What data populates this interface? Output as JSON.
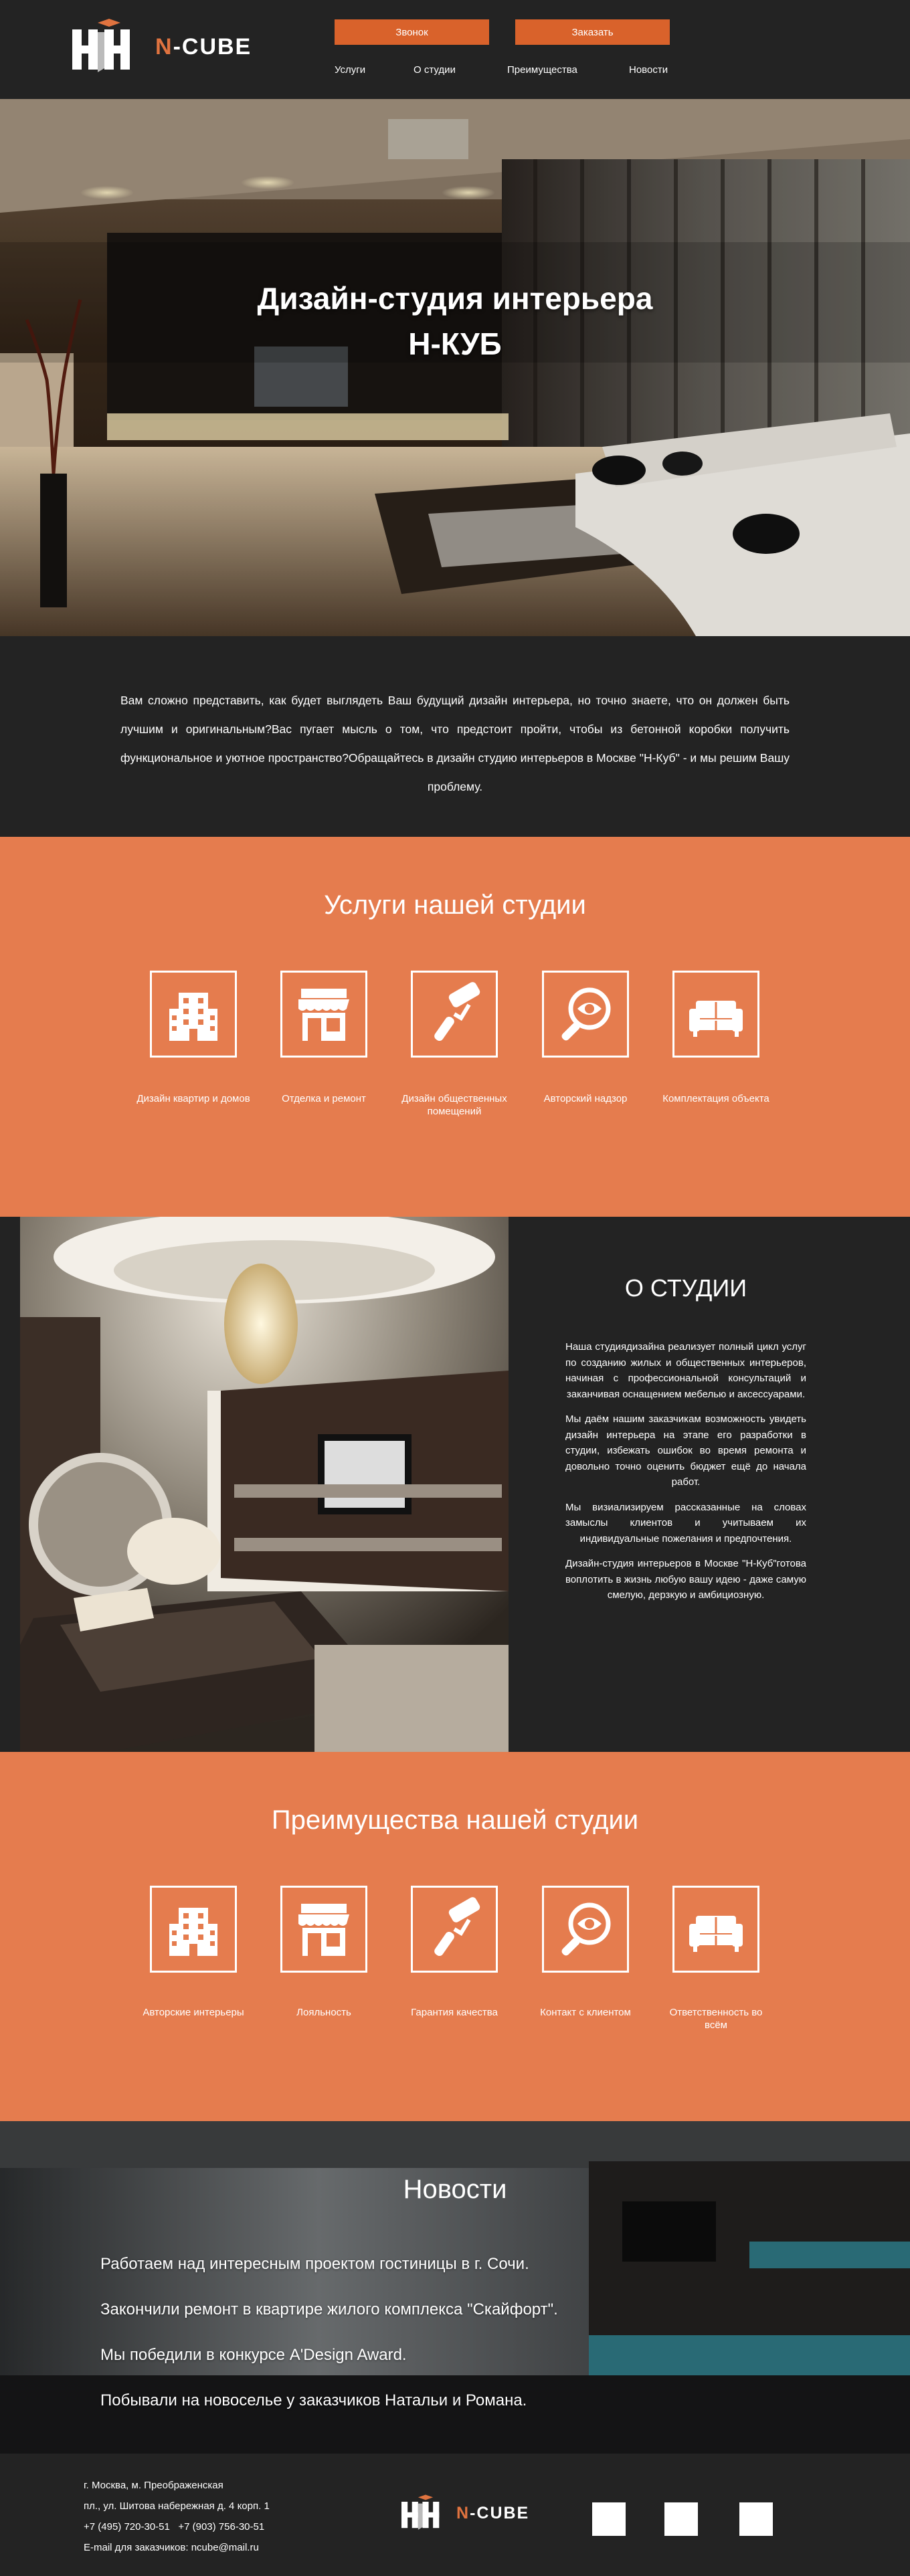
{
  "brand": {
    "logo_n": "N",
    "logo_rest": "-CUBE",
    "accent": "#d9622b",
    "orange_bg": "#e57c4e",
    "dark_bg": "#232323"
  },
  "header": {
    "call_button": "Звонок",
    "order_button": "Заказать",
    "nav": [
      "Услуги",
      "О студии",
      "Преимущества",
      "Новости"
    ]
  },
  "hero": {
    "title_line1": "Дизайн-студия интерьера",
    "title_line2": "Н-КУБ"
  },
  "intro": {
    "text": "Вам сложно представить, как будет выглядеть Ваш будущий дизайн интерьера, но точно знаете, что он должен быть лучшим и оригинальным?Вас пугает мысль о том, что предстоит пройти, чтобы из бетонной коробки получить функциональное и уютное пространство?Обращайтесь в дизайн студию интерьеров в Москве \"Н-Куб\" - и мы решим Вашу проблему."
  },
  "services": {
    "title": "Услуги нашей студии",
    "items": [
      {
        "icon": "building-icon",
        "label": "Дизайн квартир и домов"
      },
      {
        "icon": "storefront-icon",
        "label": "Отделка и ремонт"
      },
      {
        "icon": "paint-roller-icon",
        "label": "Дизайн общественных помещений"
      },
      {
        "icon": "magnifier-eye-icon",
        "label": "Авторский надзор"
      },
      {
        "icon": "sofa-icon",
        "label": "Комплектация объекта"
      }
    ]
  },
  "about": {
    "title": "О СТУДИИ",
    "paragraphs": [
      "Наша студиядизайна реализует полный цикл услуг по созданию жилых и общественных интерьеров, начиная с профессиональной консультаций и заканчивая оснащением мебелью и аксессуарами.",
      "Мы даём нашим заказчикам возможность увидеть дизайн интерьера на этапе его разработки в студии, избежать ошибок во время ремонта и довольно точно оценить бюджет ещё до начала работ.",
      "Мы визиализируем рассказанные на словах замыслы клиентов и учитываем их индивидуальные пожелания и предпочтения.",
      "Дизайн-студия интерьеров в Москве \"Н-Куб\"готова воплотить в жизнь любую вашу идею - даже самую смелую, дерзкую и амбициозную."
    ]
  },
  "advantages": {
    "title": "Преимущества нашей студии",
    "items": [
      {
        "icon": "building-icon",
        "label": "Авторские интерьеры"
      },
      {
        "icon": "storefront-icon",
        "label": "Лояльность"
      },
      {
        "icon": "paint-roller-icon",
        "label": "Гарантия качества"
      },
      {
        "icon": "magnifier-eye-icon",
        "label": "Контакт с клиентом"
      },
      {
        "icon": "sofa-icon",
        "label": "Ответственность во всём"
      }
    ]
  },
  "news": {
    "title": "Новости",
    "items": [
      "Работаем над интересным проектом гостиницы в г. Сочи.",
      "Закончили ремонт в квартире жилого комплекса \"Скайфорт\".",
      "Мы победили в конкурсе A'Design Award.",
      "Побывали на новоселье у заказчиков Натальи и Романа."
    ]
  },
  "footer": {
    "address1": "г. Москва, м. Преображенская",
    "address2": "пл., ул. Шитова набережная д. 4 корп. 1",
    "phones": "+7 (495) 720-30-51   +7 (903) 756-30-51",
    "email": "E-mail для заказчиков: ncube@mail.ru"
  }
}
